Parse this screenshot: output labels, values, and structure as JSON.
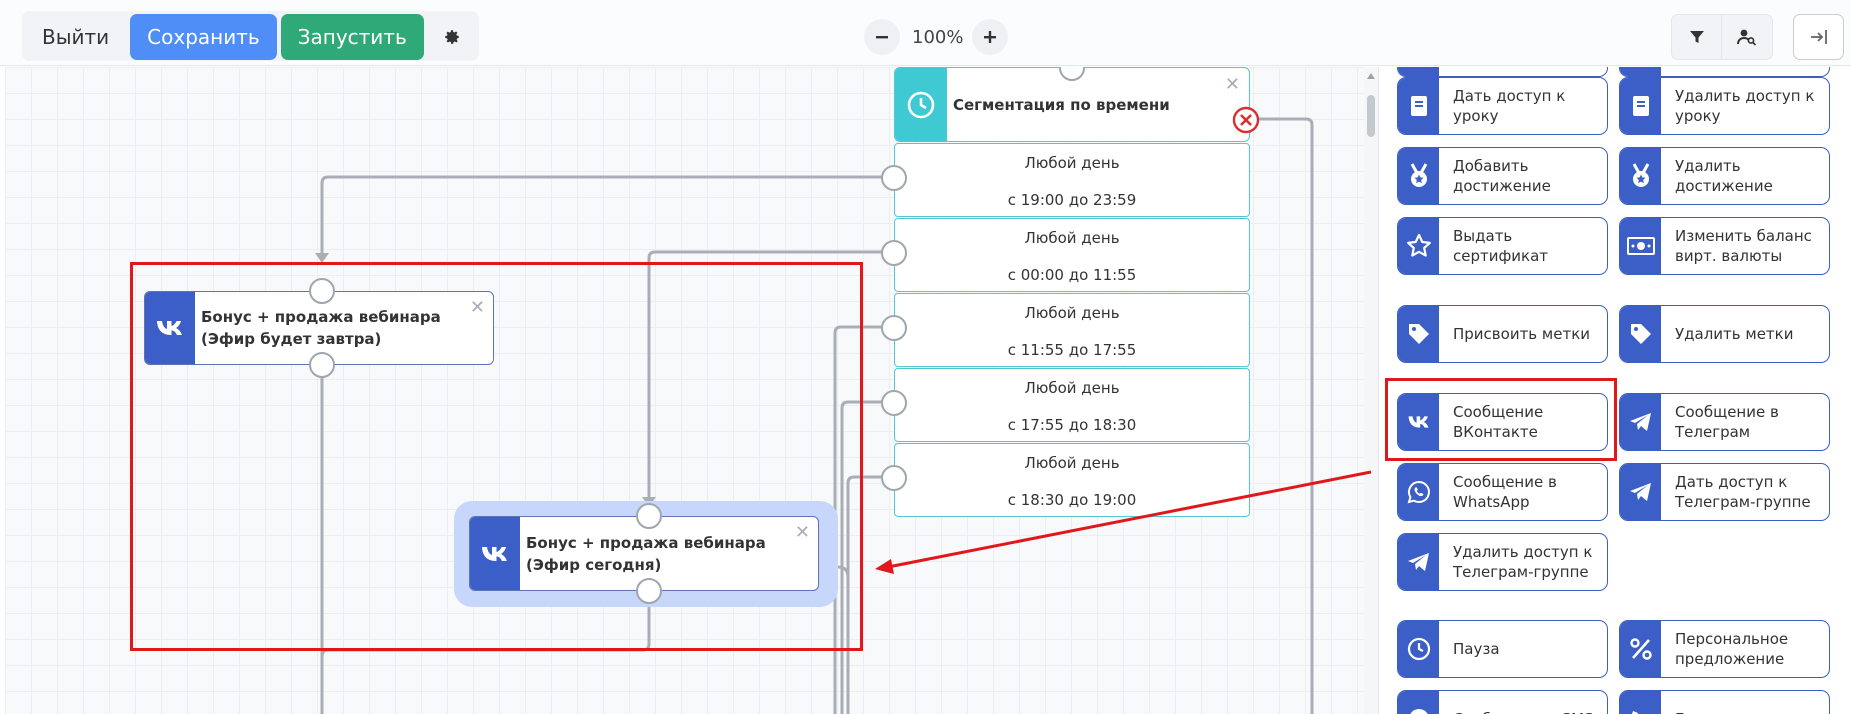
{
  "toolbar": {
    "exit_label": "Выйти",
    "save_label": "Сохранить",
    "run_label": "Запустить",
    "zoom_value": "100%"
  },
  "canvas": {
    "segmentation": {
      "title": "Сегментация по времени",
      "rows": [
        {
          "day": "Любой день",
          "time": "с 19:00 до 23:59"
        },
        {
          "day": "Любой день",
          "time": "с 00:00 до 11:55"
        },
        {
          "day": "Любой день",
          "time": "с 11:55 до 17:55"
        },
        {
          "day": "Любой день",
          "time": "с 17:55 до 18:30"
        },
        {
          "day": "Любой день",
          "time": "с 18:30 до 19:00"
        }
      ]
    },
    "node_tomorrow": {
      "title": "Бонус + продажа вебинара (Эфир будет завтра)"
    },
    "node_today": {
      "title": "Бонус + продажа вебинара (Эфир сегодня)"
    }
  },
  "panel": {
    "actions": [
      {
        "label": "Дать доступ к уроку",
        "icon": "book-icon"
      },
      {
        "label": "Удалить доступ к уроку",
        "icon": "book-icon"
      },
      {
        "label": "Добавить достижение",
        "icon": "medal-icon"
      },
      {
        "label": "Удалить достижение",
        "icon": "medal-icon"
      },
      {
        "label": "Выдать сертификат",
        "icon": "star-icon"
      },
      {
        "label": "Изменить баланс вирт. валюты",
        "icon": "money-icon"
      },
      {
        "label": "Присвоить метки",
        "icon": "tag-icon"
      },
      {
        "label": "Удалить метки",
        "icon": "tag-icon"
      },
      {
        "label": "Сообщение ВКонтакте",
        "icon": "vk-icon"
      },
      {
        "label": "Сообщение в Телеграм",
        "icon": "telegram-icon"
      },
      {
        "label": "Сообщение в WhatsApp",
        "icon": "whatsapp-icon"
      },
      {
        "label": "Дать доступ к Телеграм-группе",
        "icon": "telegram-icon"
      },
      {
        "label": "Удалить доступ к Телеграм-группе",
        "icon": "telegram-icon"
      },
      {
        "label": "Пауза",
        "icon": "clock-icon"
      },
      {
        "label": "Персональное предложение",
        "icon": "percent-icon"
      },
      {
        "label": "Сообщение в SMS",
        "icon": "sms-icon"
      },
      {
        "label": "Голосовое",
        "icon": "voice-icon"
      }
    ]
  },
  "colors": {
    "primary": "#3b5fc6",
    "save": "#4f8ef7",
    "run": "#2ea977",
    "segment": "#3ec9d3",
    "highlight": "#e0171b"
  }
}
